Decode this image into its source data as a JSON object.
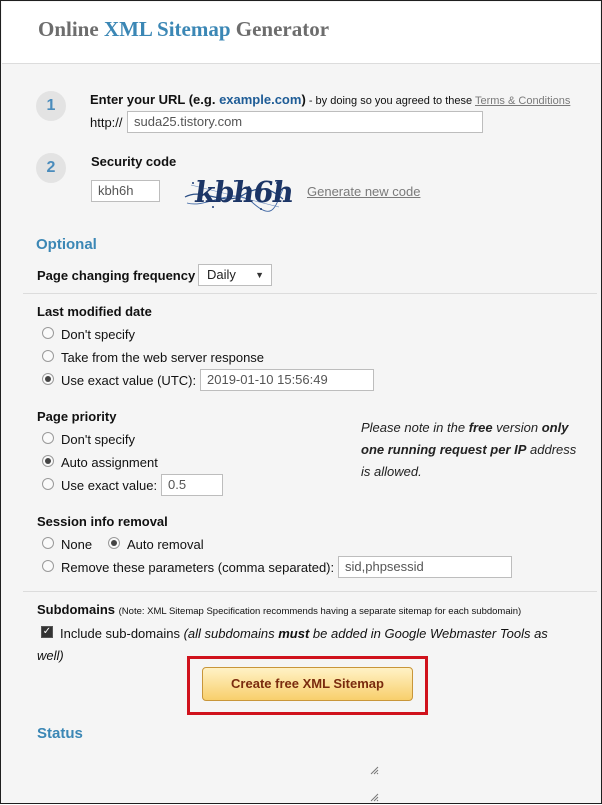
{
  "header": {
    "title_part1": "Online ",
    "title_highlight": "XML Sitemap",
    "title_part2": " Generator"
  },
  "step1": {
    "number": "1",
    "label_prefix": "Enter your URL (e.g. ",
    "label_example": "example.com",
    "label_suffix": ")",
    "agree_text": " - by doing so you agreed to these ",
    "terms_link": "Terms & Conditions",
    "protocol": "http://",
    "url_value": "suda25.tistory.com"
  },
  "step2": {
    "number": "2",
    "label": "Security code",
    "code_value": "kbh6h",
    "captcha_text": "kbh6h",
    "generate_link": "Generate new code"
  },
  "optional": {
    "title": "Optional",
    "frequency_label": "Page changing frequency",
    "frequency_value": "Daily"
  },
  "last_modified": {
    "title": "Last modified date",
    "options": [
      "Don't specify",
      "Take from the web server response",
      "Use exact value (UTC):"
    ],
    "selected": 2,
    "exact_value": "2019-01-10 15:56:49"
  },
  "priority": {
    "title": "Page priority",
    "options": [
      "Don't specify",
      "Auto assignment",
      "Use exact value:"
    ],
    "selected": 1,
    "exact_value": "0.5"
  },
  "free_note": {
    "t1": "Please note in the ",
    "t2": "free",
    "t3": " version ",
    "t4": "only",
    "t5": "one running request per IP",
    "t6": " address",
    "t7": "is allowed."
  },
  "session": {
    "title": "Session info removal",
    "option_none": "None",
    "option_auto": "Auto removal",
    "option_remove": "Remove these parameters (comma separated):",
    "selected": "auto",
    "params_value": "sid,phpsessid"
  },
  "subdomains": {
    "title": "Subdomains",
    "note": "(Note: XML Sitemap Specification recommends having a separate sitemap for each subdomain)",
    "include_label": "Include sub-domains",
    "include_note_a": " (all subdomains ",
    "include_note_must": "must",
    "include_note_b": " be added in Google Webmaster Tools as",
    "include_note_c": "well)",
    "checked": true
  },
  "cta": {
    "label": "Create free XML Sitemap"
  },
  "status": {
    "title": "Status"
  },
  "colors": {
    "accent": "#3b87b5",
    "cta_outline": "#d0121c",
    "cta_text": "#7a2b0e"
  }
}
